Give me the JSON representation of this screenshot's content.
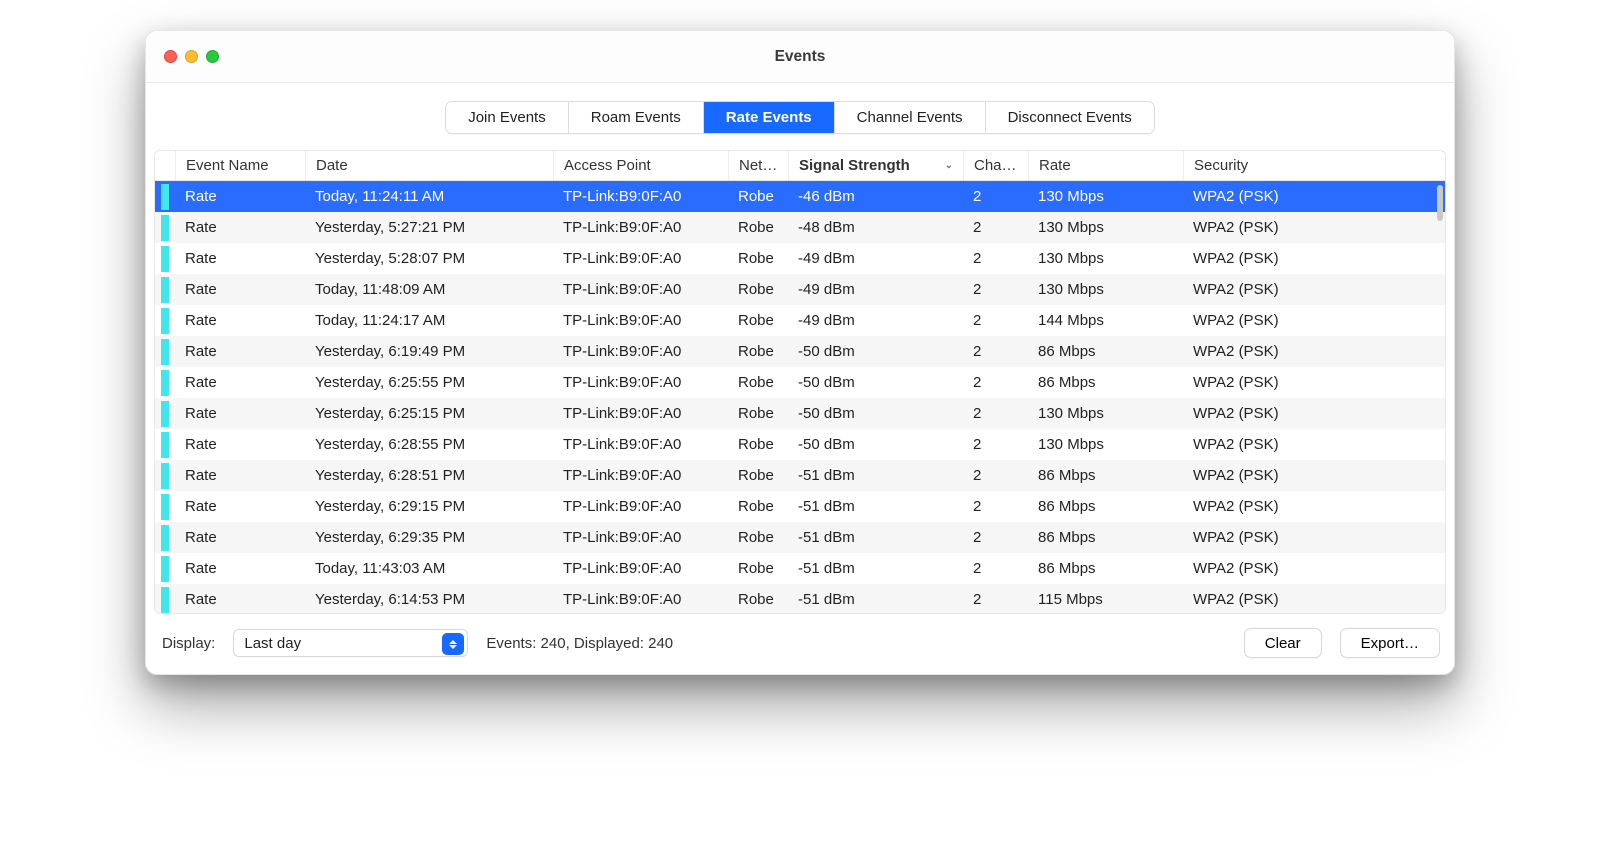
{
  "window": {
    "title": "Events"
  },
  "tabs": [
    {
      "label": "Join Events",
      "active": false
    },
    {
      "label": "Roam Events",
      "active": false
    },
    {
      "label": "Rate Events",
      "active": true
    },
    {
      "label": "Channel Events",
      "active": false
    },
    {
      "label": "Disconnect Events",
      "active": false
    }
  ],
  "columns": {
    "name": "Event Name",
    "date": "Date",
    "ap": "Access Point",
    "net": "Net…",
    "signal": "Signal Strength",
    "chan": "Cha…",
    "rate": "Rate",
    "sec": "Security"
  },
  "sorted_column": "signal",
  "rows": [
    {
      "name": "Rate",
      "date": "Today, 11:24:11 AM",
      "ap": "TP-Link:B9:0F:A0",
      "net": "Robe",
      "sig": "-46 dBm",
      "chan": "2",
      "rate": "130 Mbps",
      "sec": "WPA2 (PSK)",
      "selected": true
    },
    {
      "name": "Rate",
      "date": "Yesterday, 5:27:21 PM",
      "ap": "TP-Link:B9:0F:A0",
      "net": "Robe",
      "sig": "-48 dBm",
      "chan": "2",
      "rate": "130 Mbps",
      "sec": "WPA2 (PSK)"
    },
    {
      "name": "Rate",
      "date": "Yesterday, 5:28:07 PM",
      "ap": "TP-Link:B9:0F:A0",
      "net": "Robe",
      "sig": "-49 dBm",
      "chan": "2",
      "rate": "130 Mbps",
      "sec": "WPA2 (PSK)"
    },
    {
      "name": "Rate",
      "date": "Today, 11:48:09 AM",
      "ap": "TP-Link:B9:0F:A0",
      "net": "Robe",
      "sig": "-49 dBm",
      "chan": "2",
      "rate": "130 Mbps",
      "sec": "WPA2 (PSK)"
    },
    {
      "name": "Rate",
      "date": "Today, 11:24:17 AM",
      "ap": "TP-Link:B9:0F:A0",
      "net": "Robe",
      "sig": "-49 dBm",
      "chan": "2",
      "rate": "144 Mbps",
      "sec": "WPA2 (PSK)"
    },
    {
      "name": "Rate",
      "date": "Yesterday, 6:19:49 PM",
      "ap": "TP-Link:B9:0F:A0",
      "net": "Robe",
      "sig": "-50 dBm",
      "chan": "2",
      "rate": "86 Mbps",
      "sec": "WPA2 (PSK)"
    },
    {
      "name": "Rate",
      "date": "Yesterday, 6:25:55 PM",
      "ap": "TP-Link:B9:0F:A0",
      "net": "Robe",
      "sig": "-50 dBm",
      "chan": "2",
      "rate": "86 Mbps",
      "sec": "WPA2 (PSK)"
    },
    {
      "name": "Rate",
      "date": "Yesterday, 6:25:15 PM",
      "ap": "TP-Link:B9:0F:A0",
      "net": "Robe",
      "sig": "-50 dBm",
      "chan": "2",
      "rate": "130 Mbps",
      "sec": "WPA2 (PSK)"
    },
    {
      "name": "Rate",
      "date": "Yesterday, 6:28:55 PM",
      "ap": "TP-Link:B9:0F:A0",
      "net": "Robe",
      "sig": "-50 dBm",
      "chan": "2",
      "rate": "130 Mbps",
      "sec": "WPA2 (PSK)"
    },
    {
      "name": "Rate",
      "date": "Yesterday, 6:28:51 PM",
      "ap": "TP-Link:B9:0F:A0",
      "net": "Robe",
      "sig": "-51 dBm",
      "chan": "2",
      "rate": "86 Mbps",
      "sec": "WPA2 (PSK)"
    },
    {
      "name": "Rate",
      "date": "Yesterday, 6:29:15 PM",
      "ap": "TP-Link:B9:0F:A0",
      "net": "Robe",
      "sig": "-51 dBm",
      "chan": "2",
      "rate": "86 Mbps",
      "sec": "WPA2 (PSK)"
    },
    {
      "name": "Rate",
      "date": "Yesterday, 6:29:35 PM",
      "ap": "TP-Link:B9:0F:A0",
      "net": "Robe",
      "sig": "-51 dBm",
      "chan": "2",
      "rate": "86 Mbps",
      "sec": "WPA2 (PSK)"
    },
    {
      "name": "Rate",
      "date": "Today, 11:43:03 AM",
      "ap": "TP-Link:B9:0F:A0",
      "net": "Robe",
      "sig": "-51 dBm",
      "chan": "2",
      "rate": "86 Mbps",
      "sec": "WPA2 (PSK)"
    },
    {
      "name": "Rate",
      "date": "Yesterday, 6:14:53 PM",
      "ap": "TP-Link:B9:0F:A0",
      "net": "Robe",
      "sig": "-51 dBm",
      "chan": "2",
      "rate": "115 Mbps",
      "sec": "WPA2 (PSK)"
    }
  ],
  "footer": {
    "display_label": "Display:",
    "select_value": "Last day",
    "status": "Events: 240, Displayed: 240",
    "clear": "Clear",
    "export": "Export…"
  }
}
